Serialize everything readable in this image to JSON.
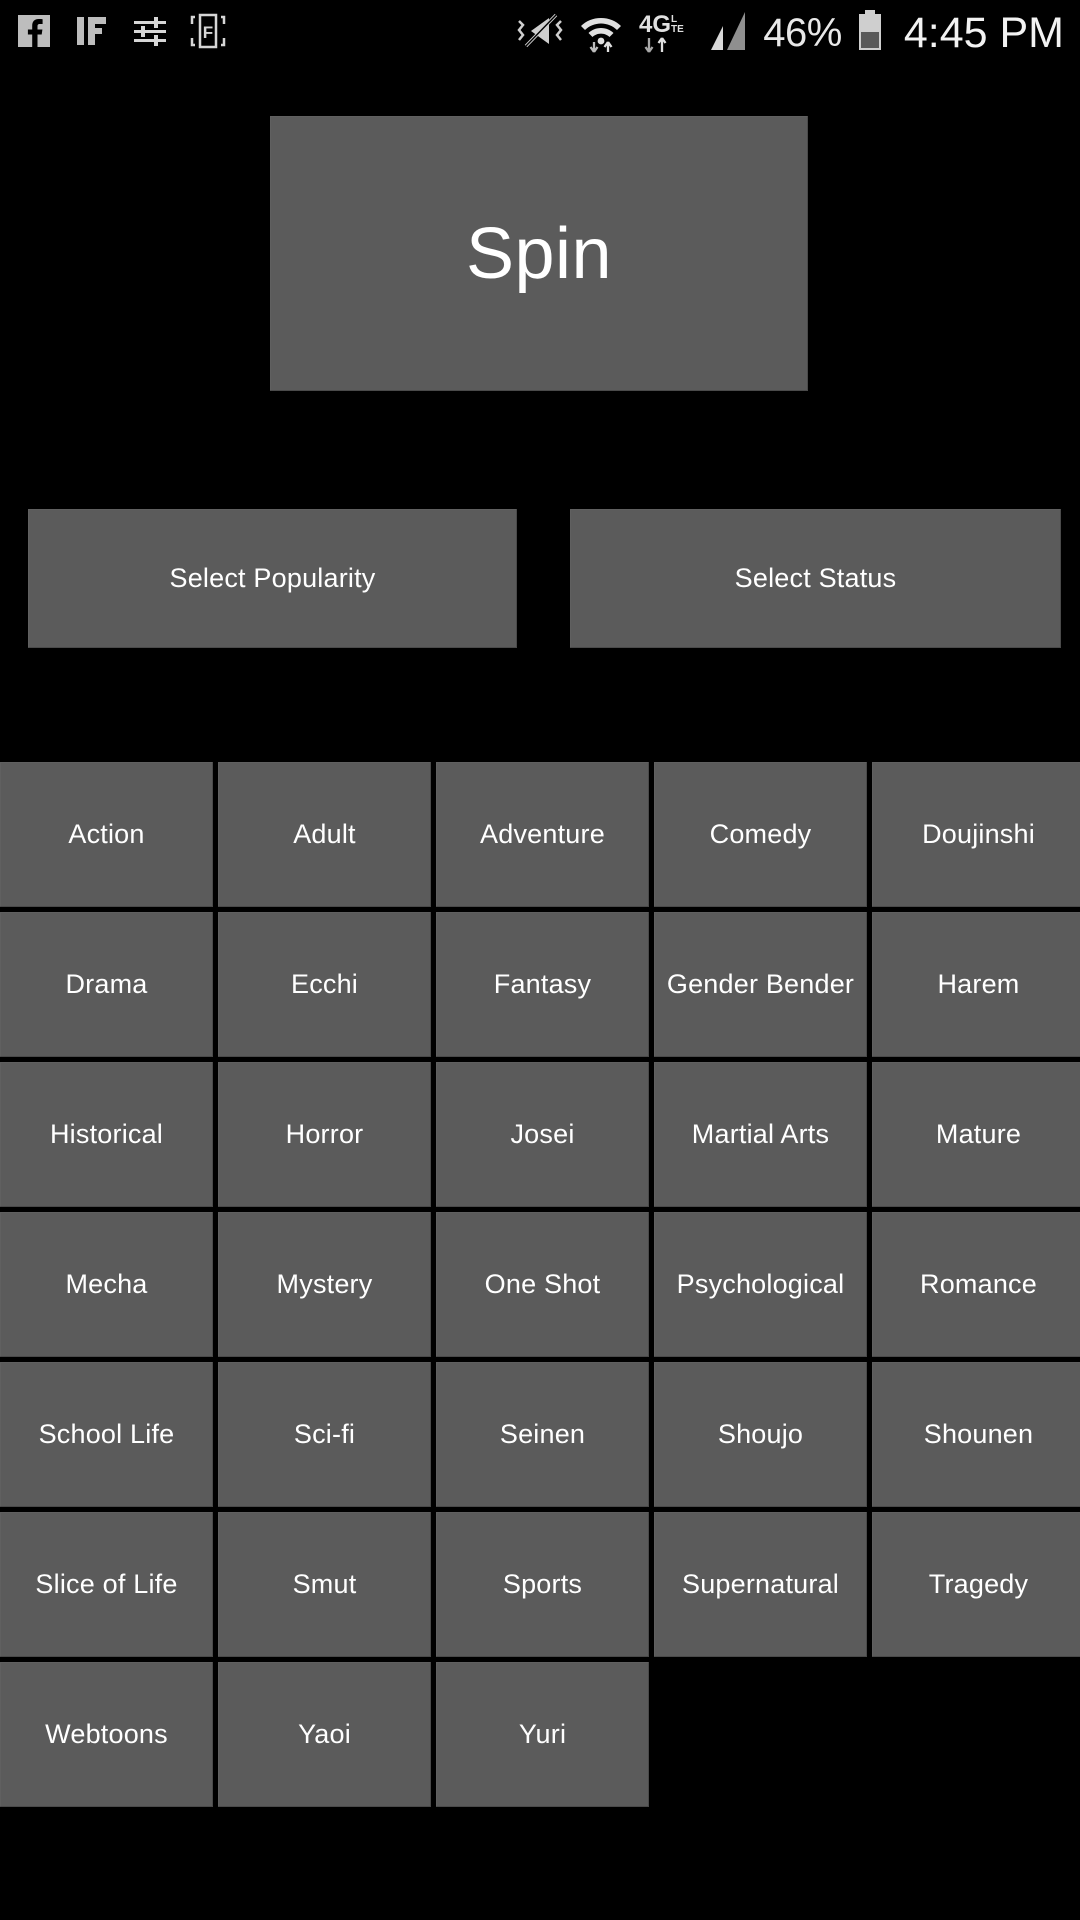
{
  "status_bar": {
    "notification_icons": [
      {
        "name": "facebook-icon",
        "label": "Facebook"
      },
      {
        "name": "if-app-icon",
        "label": "IF"
      },
      {
        "name": "equalizer-sliders-icon",
        "label": "Equalizer"
      },
      {
        "name": "f-bracket-app-icon",
        "label": "F"
      }
    ],
    "system_icons": [
      {
        "name": "vibrate-off-icon",
        "label": "Vibrate off"
      },
      {
        "name": "wifi-icon",
        "label": "Wi-Fi"
      },
      {
        "name": "network-4g-lte-icon",
        "label": "4G LTE"
      },
      {
        "name": "cellular-signal-icon",
        "label": "Signal"
      }
    ],
    "battery_percent": "46%",
    "clock": "4:45 PM"
  },
  "main": {
    "spin_button_label": "Spin",
    "filters": [
      {
        "name": "select-popularity-button",
        "label": "Select Popularity"
      },
      {
        "name": "select-status-button",
        "label": "Select Status"
      }
    ],
    "genres": [
      "Action",
      "Adult",
      "Adventure",
      "Comedy",
      "Doujinshi",
      "Drama",
      "Ecchi",
      "Fantasy",
      "Gender Bender",
      "Harem",
      "Historical",
      "Horror",
      "Josei",
      "Martial Arts",
      "Mature",
      "Mecha",
      "Mystery",
      "One Shot",
      "Psychological",
      "Romance",
      "School Life",
      "Sci-fi",
      "Seinen",
      "Shoujo",
      "Shounen",
      "Slice of Life",
      "Smut",
      "Sports",
      "Supernatural",
      "Tragedy",
      "Webtoons",
      "Yaoi",
      "Yuri"
    ]
  },
  "colors": {
    "background": "#000000",
    "tile": "#5b5b5b",
    "tile_text": "#ffffff",
    "status_text": "#e8e8e8"
  }
}
